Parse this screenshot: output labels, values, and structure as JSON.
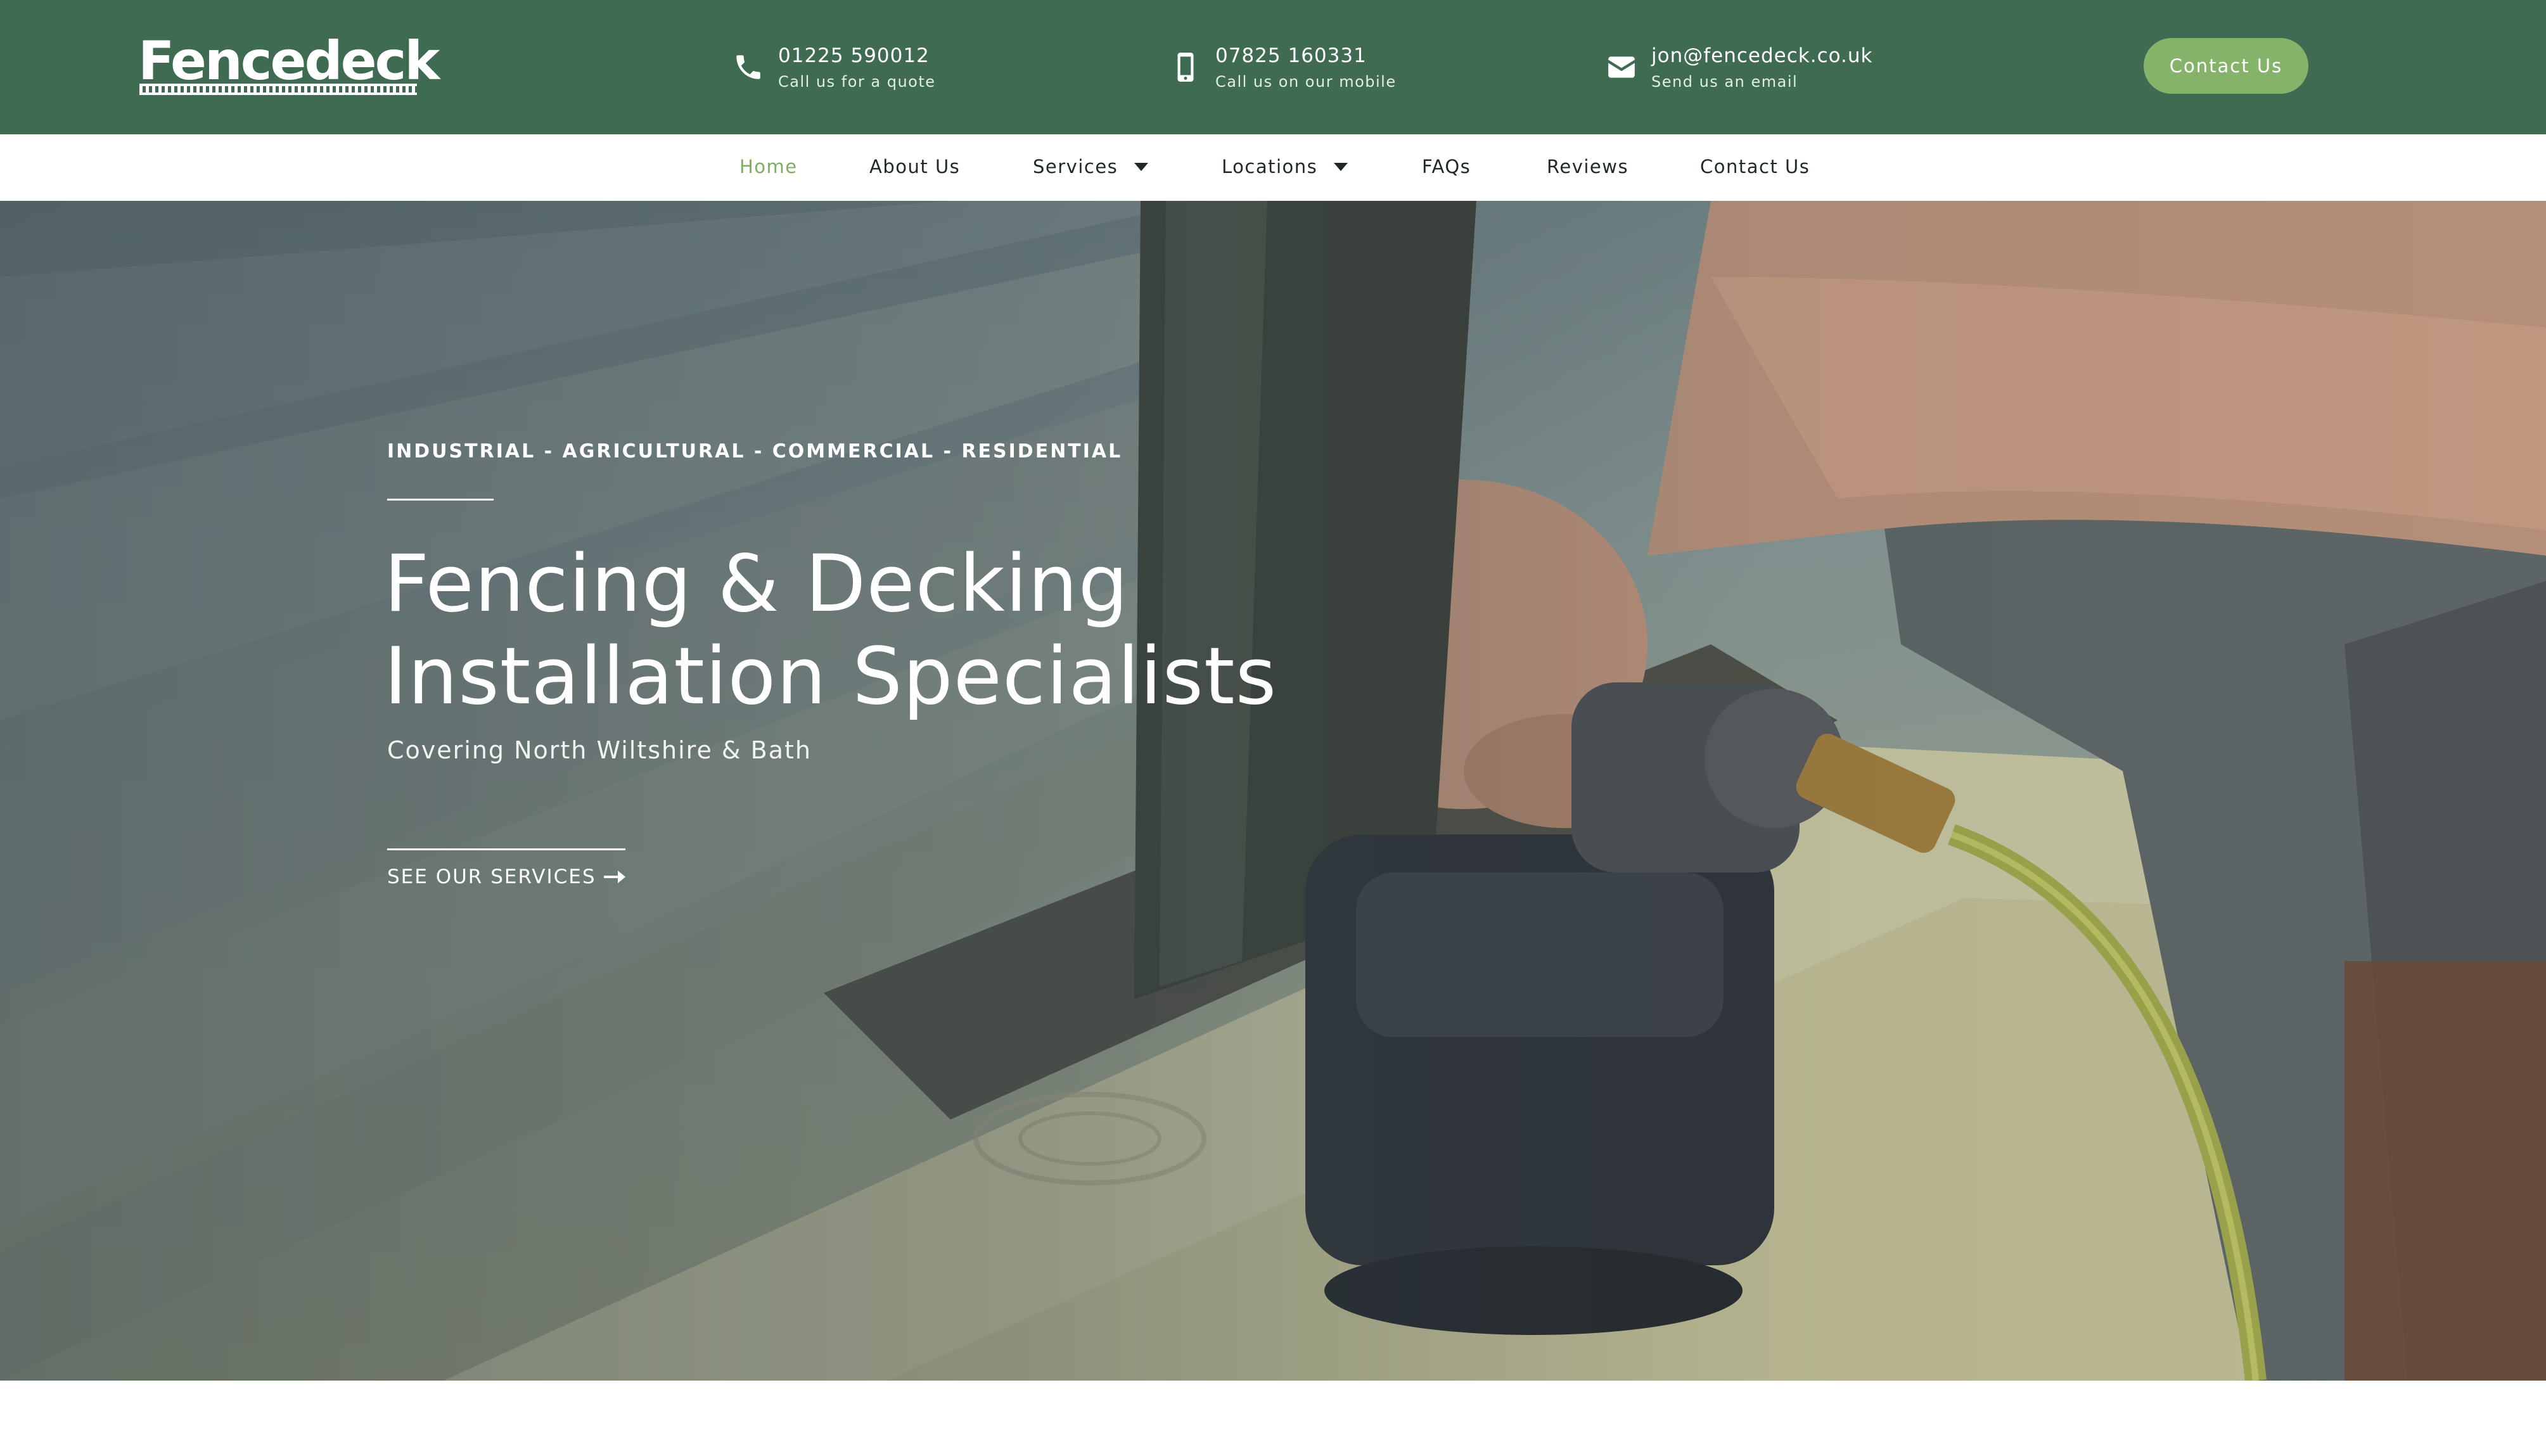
{
  "header": {
    "logo_text": "Fencedeck",
    "contacts": [
      {
        "icon": "phone-icon",
        "main": "01225 590012",
        "sub": "Call us for a quote"
      },
      {
        "icon": "mobile-icon",
        "main": "07825 160331",
        "sub": "Call us on our mobile"
      },
      {
        "icon": "envelope-icon",
        "main": "jon@fencedeck.co.uk",
        "sub": "Send us an email"
      }
    ],
    "contact_button": "Contact Us"
  },
  "nav": {
    "items": [
      {
        "label": "Home",
        "active": true
      },
      {
        "label": "About Us"
      },
      {
        "label": "Services",
        "dropdown": true
      },
      {
        "label": "Locations",
        "dropdown": true
      },
      {
        "label": "FAQs"
      },
      {
        "label": "Reviews"
      },
      {
        "label": "Contact Us"
      }
    ]
  },
  "hero": {
    "tagline": "INDUSTRIAL - AGRICULTURAL - COMMERCIAL - RESIDENTIAL",
    "title_line1": "Fencing & Decking",
    "title_line2": "Installation Specialists",
    "subtitle": "Covering North Wiltshire & Bath",
    "cta_label": "SEE OUR SERVICES",
    "cta_icon": "arrow-right-icon"
  },
  "colors": {
    "header_bg": "#3f6b53",
    "accent_green": "#86b36a",
    "nav_active": "#7fae63",
    "nav_text": "#1f2a23",
    "white": "#ffffff"
  }
}
